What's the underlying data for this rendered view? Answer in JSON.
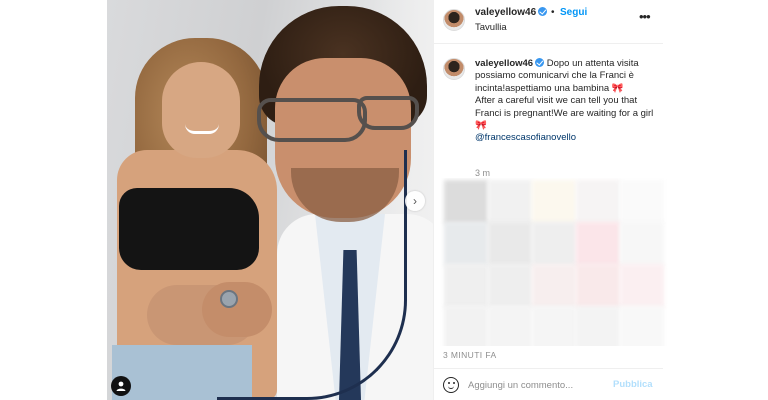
{
  "post": {
    "author": "valeyellow46",
    "follow_label": "Segui",
    "separator": "•",
    "location": "Tavullia",
    "more_icon": "more-horizontal-icon",
    "verified_icon": "verified-badge-icon"
  },
  "caption": {
    "author": "valeyellow46",
    "line_it_1": "Dopo un attenta visita possiamo comunicarvi che la Franci è incinta!aspettiamo una bambina",
    "bow_1": "🎀",
    "line_en_1": "After a careful visit we can tell you that Franci is pregnant!We are waiting for a girl",
    "bow_2": "🎀",
    "mention": "@francescasofianovello",
    "time": "3 m"
  },
  "photo": {
    "next_icon": "chevron-right-icon",
    "tag_icon": "user-tag-icon"
  },
  "footer": {
    "time_ago": "3 MINUTI FA",
    "comment_placeholder": "Aggiungi un commento...",
    "publish_label": "Pubblica",
    "emoji_icon": "emoji-smile-icon"
  },
  "colors": {
    "accent": "#0095f6",
    "publish_disabled": "#b2dffc",
    "mention": "#00376b",
    "verified": "#3897f0"
  }
}
